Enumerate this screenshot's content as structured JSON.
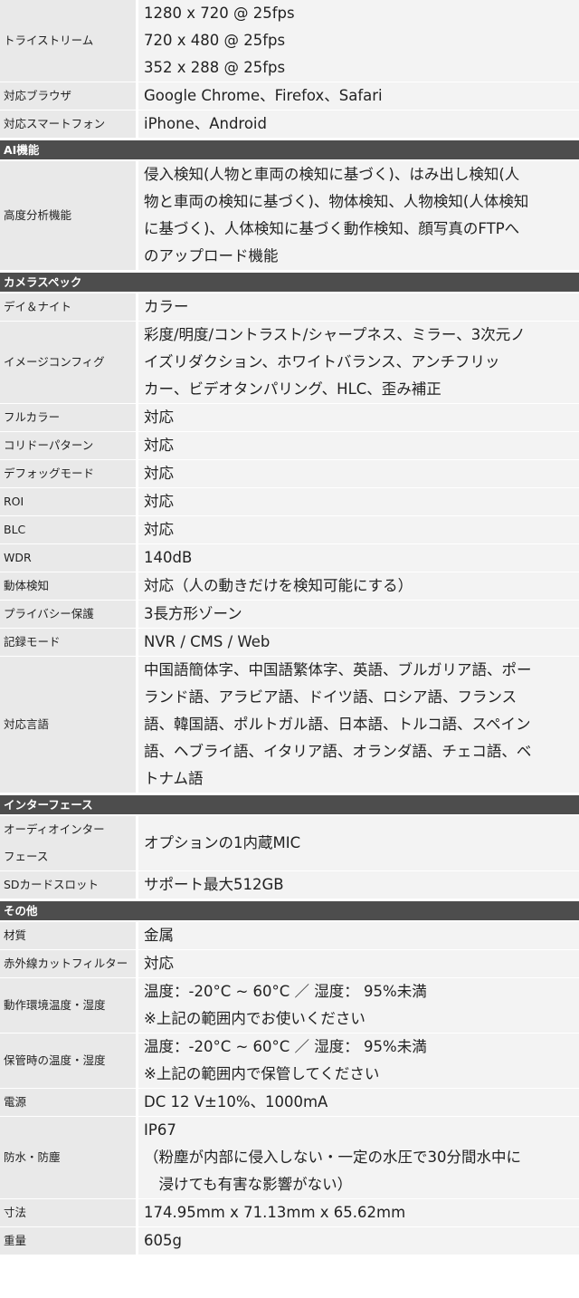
{
  "rows": [
    {
      "label": "トライストリーム",
      "value": "1280 x 720 @ 25fps\n720 x 480 @ 25fps\n352 x 288 @ 25fps"
    },
    {
      "label": "対応ブラウザ",
      "value": "Google Chrome、Firefox、Safari"
    },
    {
      "label": "対応スマートフォン",
      "value": "iPhone、Android"
    },
    {
      "section": "AI機能"
    },
    {
      "label": "高度分析機能",
      "value": "侵入検知(人物と車両の検知に基づく)、はみ出し検知(人\n物と車両の検知に基づく)、物体検知、人物検知(人体検知\nに基づく)、人体検知に基づく動作検知、顔写真のFTPへ\nのアップロード機能"
    },
    {
      "section": "カメラスペック"
    },
    {
      "label": "デイ＆ナイト",
      "value": "カラー"
    },
    {
      "label": "イメージコンフィグ",
      "value": "彩度/明度/コントラスト/シャープネス、ミラー、3次元ノ\nイズリダクション、ホワイトバランス、アンチフリッ\nカー、ビデオタンパリング、HLC、歪み補正"
    },
    {
      "label": "フルカラー",
      "value": "対応"
    },
    {
      "label": "コリドーパターン",
      "value": "対応"
    },
    {
      "label": "デフォッグモード",
      "value": "対応"
    },
    {
      "label": "ROI",
      "value": "対応"
    },
    {
      "label": "BLC",
      "value": "対応"
    },
    {
      "label": "WDR",
      "value": "140dB"
    },
    {
      "label": "動体検知",
      "value": "対応（人の動きだけを検知可能にする）"
    },
    {
      "label": "プライバシー保護",
      "value": "3長方形ゾーン"
    },
    {
      "label": "記録モード",
      "value": "NVR / CMS / Web"
    },
    {
      "label": "対応言語",
      "value": "中国語簡体字、中国語繁体字、英語、ブルガリア語、ポー\nランド語、アラビア語、ドイツ語、ロシア語、フランス\n語、韓国語、ポルトガル語、日本語、トルコ語、スペイン\n語、ヘブライ語、イタリア語、オランダ語、チェコ語、ベ\nトナム語"
    },
    {
      "section": "インターフェース"
    },
    {
      "label": "オーディオインター\nフェース",
      "value": "オプションの1内蔵MIC"
    },
    {
      "label": "SDカードスロット",
      "value": "サポート最大512GB"
    },
    {
      "section": "その他"
    },
    {
      "label": "材質",
      "value": "金属"
    },
    {
      "label": "赤外線カットフィルター",
      "value": "対応"
    },
    {
      "label": "動作環境温度・湿度",
      "value": "温度：-20°C ~ 60°C ／ 湿度： 95%未満\n※上記の範囲内でお使いください"
    },
    {
      "label": "保管時の温度・湿度",
      "value": "温度：-20°C ~ 60°C ／ 湿度： 95%未満\n※上記の範囲内で保管してください"
    },
    {
      "label": "電源",
      "value": "DC 12 V±10%、1000mA"
    },
    {
      "label": "防水・防塵",
      "value": "IP67\n（粉塵が内部に侵入しない・一定の水圧で30分間水中に\n　浸けても有害な影響がない）"
    },
    {
      "label": "寸法",
      "value": "174.95mm x 71.13mm x 65.62mm"
    },
    {
      "label": "重量",
      "value": "605g"
    }
  ]
}
